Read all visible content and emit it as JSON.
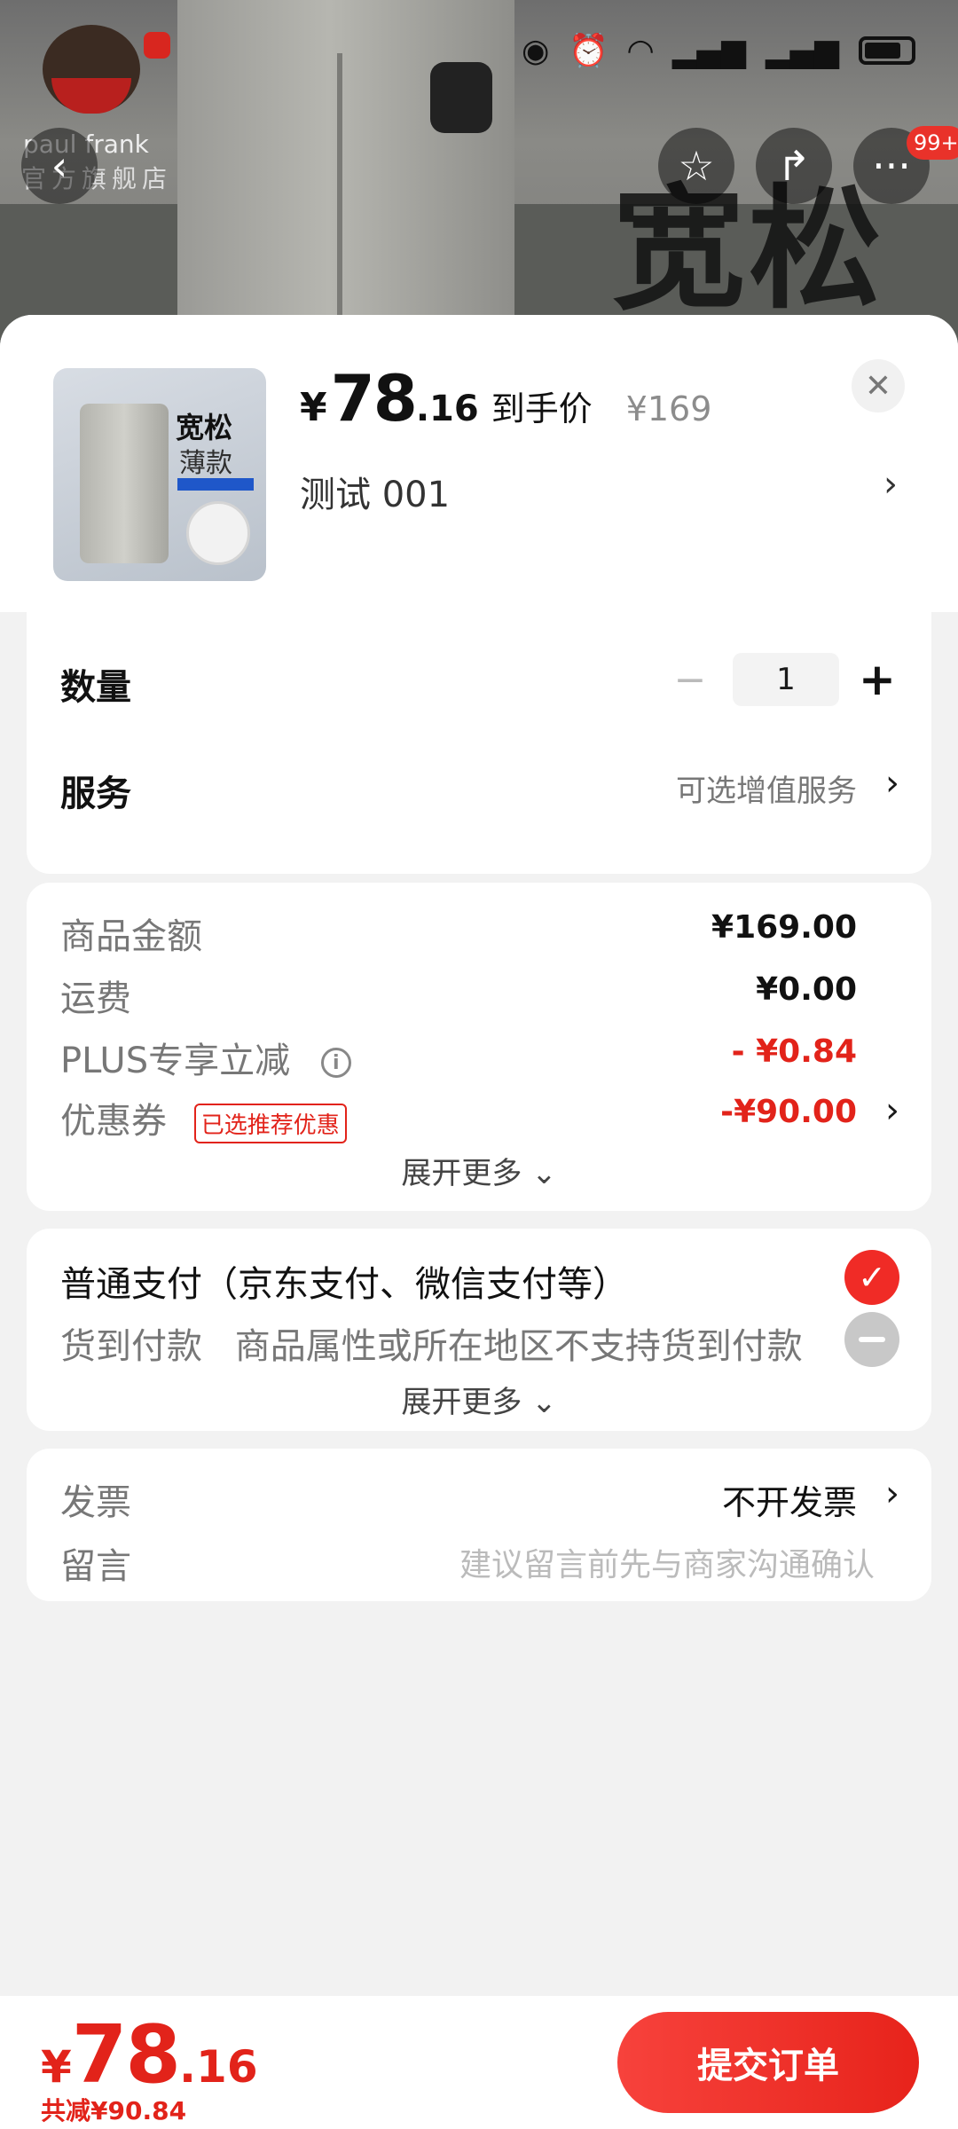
{
  "background": {
    "brand_name": "paul frank",
    "store_name": "官方旗舰店",
    "headline": "宽松",
    "notification_badge": "99+"
  },
  "product": {
    "currency": "¥",
    "price_int": "78",
    "price_dec": ".16",
    "price_tag": "到手价",
    "original_price": "¥169",
    "thumb_word1": "宽松",
    "thumb_word2": "薄款",
    "variant": "测试  001"
  },
  "quantity": {
    "label": "数量",
    "value": "1"
  },
  "service": {
    "label": "服务",
    "value": "可选增值服务"
  },
  "costs": {
    "goods_label": "商品金额",
    "goods_value": "¥169.00",
    "shipping_label": "运费",
    "shipping_value": "¥0.00",
    "plus_label": "PLUS专享立减",
    "plus_value": "- ¥0.84",
    "coupon_label": "优惠券",
    "coupon_tag": "已选推荐优惠",
    "coupon_value": "-¥90.00",
    "expand": "展开更多"
  },
  "payment": {
    "normal_label": "普通支付（京东支付、微信支付等）",
    "cod_label": "货到付款",
    "cod_note": "商品属性或所在地区不支持货到付款",
    "expand": "展开更多"
  },
  "extra": {
    "invoice_label": "发票",
    "invoice_value": "不开发票",
    "note_label": "留言",
    "note_placeholder": "建议留言前先与商家沟通确认"
  },
  "footer": {
    "currency": "¥",
    "total_int": "78",
    "total_dec": ".16",
    "saving": "共减¥90.84",
    "submit": "提交订单"
  },
  "colors": {
    "accent": "#e2231a",
    "check": "#f02b26"
  }
}
